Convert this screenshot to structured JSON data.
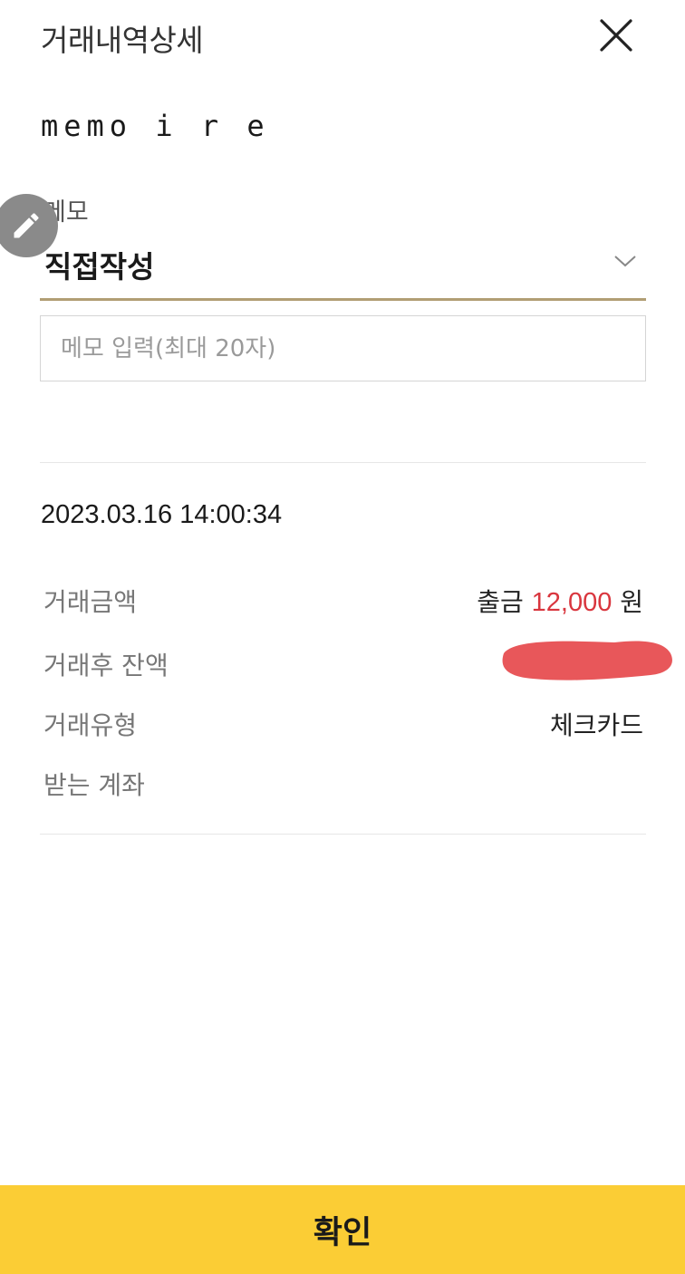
{
  "header": {
    "title": "거래내역상세",
    "close_icon": "close-icon"
  },
  "brand": {
    "name": "memo i r e"
  },
  "memo": {
    "label": "메모",
    "select_value": "직접작성",
    "input_placeholder": "메모 입력(최대 20자)",
    "input_value": "",
    "edit_icon": "pencil-icon"
  },
  "transaction": {
    "datetime": "2023.03.16 14:00:34",
    "rows": [
      {
        "label": "거래금액",
        "type_text": "출금",
        "amount": "12,000",
        "unit": "원"
      },
      {
        "label": "거래후 잔액",
        "value": ""
      },
      {
        "label": "거래유형",
        "value": "체크카드"
      },
      {
        "label": "받는 계좌",
        "value": ""
      }
    ]
  },
  "footer": {
    "confirm_label": "확인"
  },
  "colors": {
    "accent_underline": "#b19e74",
    "amount_red": "#d9363e",
    "confirm_yellow": "#fbcd35",
    "redaction_red": "#e8575a"
  }
}
